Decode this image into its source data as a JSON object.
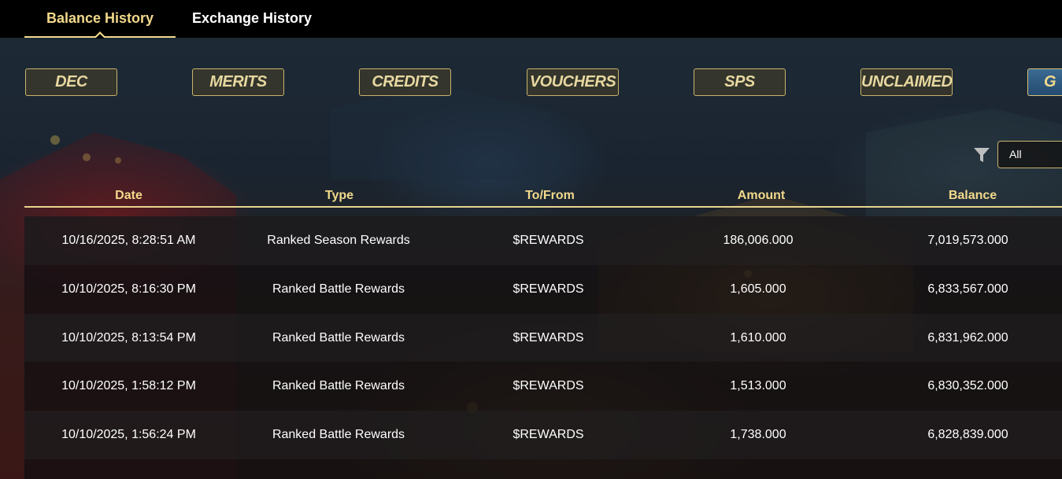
{
  "tabs": {
    "balance_history": "Balance History",
    "exchange_history": "Exchange History"
  },
  "currency_buttons": [
    "DEC",
    "MERITS",
    "CREDITS",
    "VOUCHERS",
    "SPS",
    "UNCLAIMED",
    "G"
  ],
  "filter": {
    "selected": "All"
  },
  "table": {
    "headers": {
      "date": "Date",
      "type": "Type",
      "tofrom": "To/From",
      "amount": "Amount",
      "balance": "Balance"
    },
    "rows": [
      {
        "date": "10/16/2025, 8:28:51 AM",
        "type": "Ranked Season Rewards",
        "tofrom": "$REWARDS",
        "amount": "186,006.000",
        "balance": "7,019,573.000"
      },
      {
        "date": "10/10/2025, 8:16:30 PM",
        "type": "Ranked Battle Rewards",
        "tofrom": "$REWARDS",
        "amount": "1,605.000",
        "balance": "6,833,567.000"
      },
      {
        "date": "10/10/2025, 8:13:54 PM",
        "type": "Ranked Battle Rewards",
        "tofrom": "$REWARDS",
        "amount": "1,610.000",
        "balance": "6,831,962.000"
      },
      {
        "date": "10/10/2025, 1:58:12 PM",
        "type": "Ranked Battle Rewards",
        "tofrom": "$REWARDS",
        "amount": "1,513.000",
        "balance": "6,830,352.000"
      },
      {
        "date": "10/10/2025, 1:56:24 PM",
        "type": "Ranked Battle Rewards",
        "tofrom": "$REWARDS",
        "amount": "1,738.000",
        "balance": "6,828,839.000"
      }
    ]
  },
  "colors": {
    "accent_gold": "#f2d98b",
    "button_border": "#c9b46d",
    "active_button_blue": "#3b6a93"
  },
  "icons": {
    "filter": "filter-funnel-icon"
  }
}
